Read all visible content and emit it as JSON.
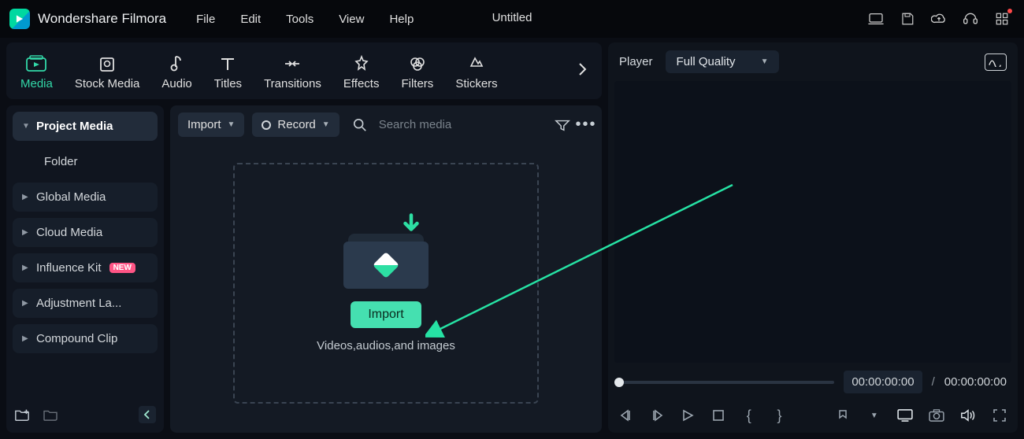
{
  "app": {
    "brand": "Wondershare Filmora",
    "document_title": "Untitled"
  },
  "menu": {
    "file": "File",
    "edit": "Edit",
    "tools": "Tools",
    "view": "View",
    "help": "Help"
  },
  "category_tabs": {
    "media": "Media",
    "stock": "Stock Media",
    "audio": "Audio",
    "titles": "Titles",
    "transitions": "Transitions",
    "effects": "Effects",
    "filters": "Filters",
    "stickers": "Stickers"
  },
  "sidebar": {
    "project_media": "Project Media",
    "folder": "Folder",
    "global_media": "Global Media",
    "cloud_media": "Cloud Media",
    "influence_kit": "Influence Kit",
    "influence_badge": "NEW",
    "adjustment": "Adjustment La...",
    "compound": "Compound Clip"
  },
  "content_toolbar": {
    "import_label": "Import",
    "record_label": "Record",
    "search_placeholder": "Search media"
  },
  "dropzone": {
    "import_button": "Import",
    "caption": "Videos,audios,and images"
  },
  "player": {
    "title": "Player",
    "quality": "Full Quality",
    "time_current": "00:00:00:00",
    "time_sep": "/",
    "time_total": "00:00:00:00"
  }
}
